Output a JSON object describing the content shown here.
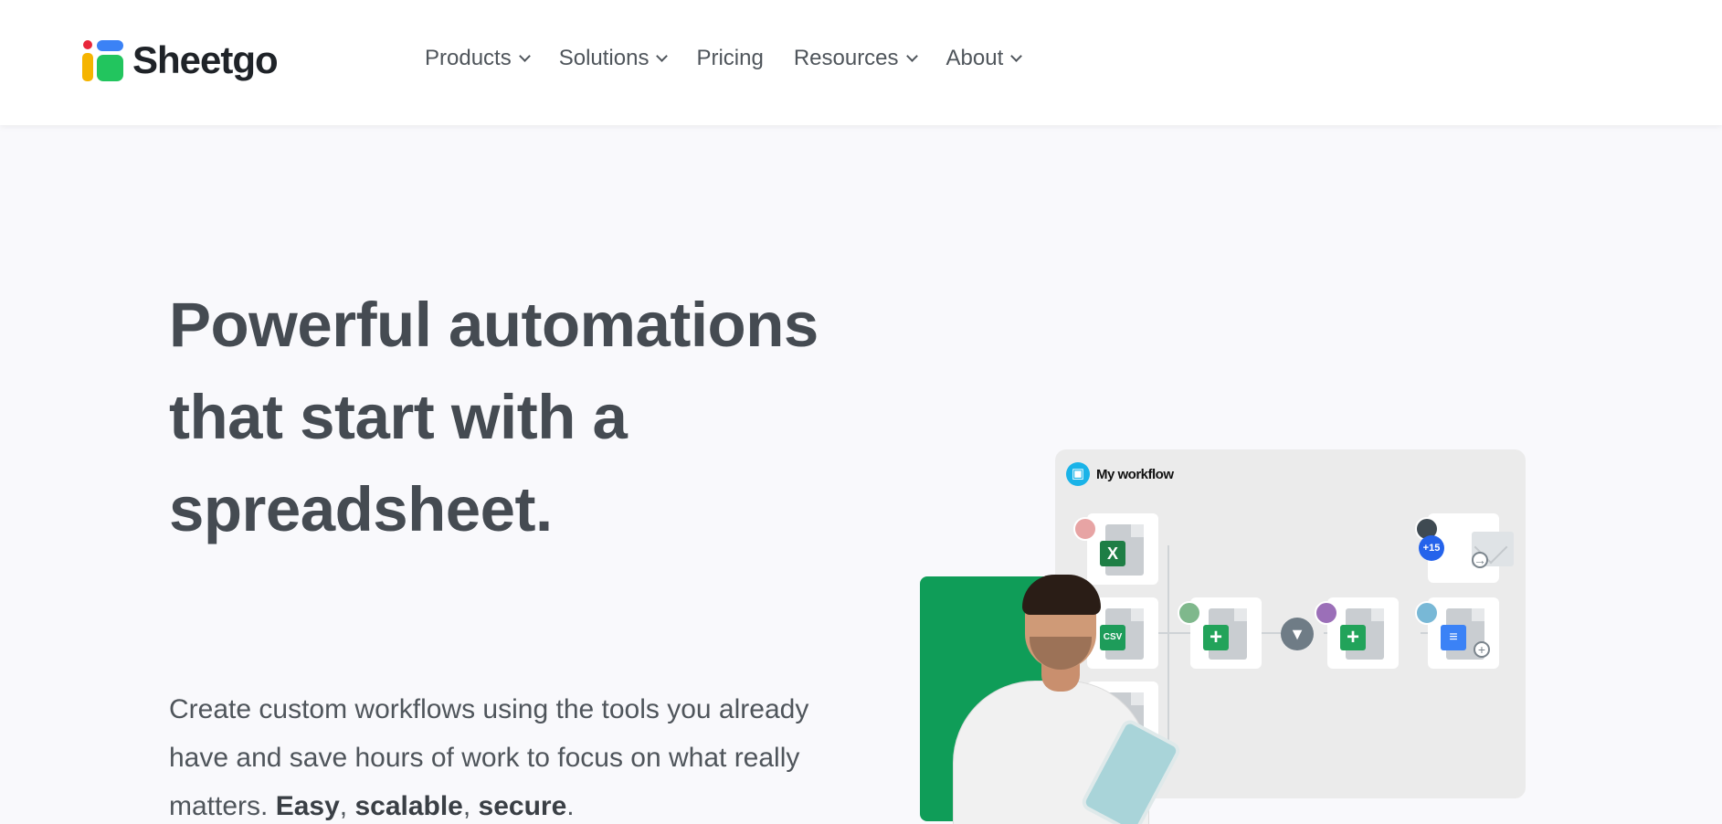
{
  "header": {
    "logo_text": "Sheetgo",
    "nav": [
      {
        "label": "Products",
        "has_dropdown": true
      },
      {
        "label": "Solutions",
        "has_dropdown": true
      },
      {
        "label": "Pricing",
        "has_dropdown": false
      },
      {
        "label": "Resources",
        "has_dropdown": true
      },
      {
        "label": "About",
        "has_dropdown": true
      }
    ]
  },
  "hero": {
    "headline": "Powerful automations that start with a spreadsheet.",
    "subtext_plain": "Create custom workflows using the tools you already have and save hours of work to focus on what really matters. ",
    "subtext_easy": "Easy",
    "subtext_sep1": ", ",
    "subtext_scalable": "scalable",
    "subtext_sep2": ", ",
    "subtext_secure": "secure",
    "subtext_end": "."
  },
  "illustration": {
    "workflow_title": "My workflow",
    "excel_badge": "X",
    "csv_badge": "CSV",
    "sheets_badge": "+",
    "collaborators_count": "+15",
    "colors": {
      "brand_green": "#0f9d58",
      "accent_blue": "#1ab3e8",
      "excel_green": "#1e7e45"
    }
  }
}
